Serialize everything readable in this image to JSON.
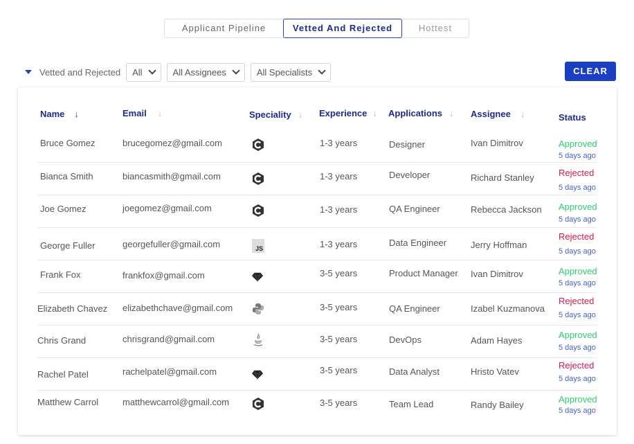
{
  "tabs": [
    {
      "label": "Applicant Pipeline"
    },
    {
      "label": "Vetted And Rejected"
    },
    {
      "label": "Hottest"
    }
  ],
  "filters": {
    "section_label": "Vetted and Rejected",
    "status_select": "All",
    "assignee_select": "All Assignees",
    "specialist_select": "All Specialists",
    "clear_label": "CLEAR"
  },
  "table": {
    "headers": {
      "name": "Name",
      "email": "Email",
      "speciality": "Speciality",
      "experience": "Experience",
      "applications": "Applications",
      "assignee": "Assignee",
      "status": "Status"
    },
    "rows": [
      {
        "name": "Bruce Gomez",
        "email": "brucegomez@gmail.com",
        "speciality_icon": "c-hexagon-icon",
        "experience": "1-3 years",
        "application": "Designer",
        "assignee": "Ivan Dimitrov",
        "status": "Approved",
        "ago": "5 days ago"
      },
      {
        "name": "Bianca Smith",
        "email": "biancasmith@gmail.com",
        "speciality_icon": "c-hexagon-icon",
        "experience": "1-3 years",
        "application": "Developer",
        "assignee": "Richard Stanley",
        "status": "Rejected",
        "ago": "5 days ago"
      },
      {
        "name": "Joe Gomez",
        "email": "joegomez@gmail.com",
        "speciality_icon": "c-hexagon-icon",
        "experience": "1-3 years",
        "application": "QA Engineer",
        "assignee": "Rebecca Jackson",
        "status": "Approved",
        "ago": "5 days ago"
      },
      {
        "name": "George Fuller",
        "email": "georgefuller@gmail.com",
        "speciality_icon": "js-icon",
        "experience": "1-3 years",
        "application": "Data Engineer",
        "assignee": "Jerry Hoffman",
        "status": "Rejected",
        "ago": "5 days ago"
      },
      {
        "name": "Frank Fox",
        "email": "frankfox@gmail.com",
        "speciality_icon": "ruby-icon",
        "experience": "3-5 years",
        "application": "Product Manager",
        "assignee": "Ivan Dimitrov",
        "status": "Approved",
        "ago": "5 days ago"
      },
      {
        "name": "Elizabeth Chavez",
        "email": "elizabethchave@gmail.com",
        "speciality_icon": "python-icon",
        "experience": "3-5 years",
        "application": "QA Engineer",
        "assignee": "Izabel Kuzmanova",
        "status": "Rejected",
        "ago": "5 days ago"
      },
      {
        "name": "Chris Grand",
        "email": "chrisgrand@gmail.com",
        "speciality_icon": "java-icon",
        "experience": "3-5 years",
        "application": "DevOps",
        "assignee": "Adam Hayes",
        "status": "Approved",
        "ago": "5 days ago"
      },
      {
        "name": "Rachel Patel",
        "email": "rachelpatel@gmail.com",
        "speciality_icon": "ruby-icon",
        "experience": "3-5 years",
        "application": "Data Analyst",
        "assignee": "Hristo Vatev",
        "status": "Rejected",
        "ago": "5 days ago"
      },
      {
        "name": "Matthew Carrol",
        "email": "matthewcarrol@gmail.com",
        "speciality_icon": "c-hexagon-icon",
        "experience": "3-5 years",
        "application": "Team Lead",
        "assignee": "Randy Bailey",
        "status": "Approved",
        "ago": "5 days ago"
      }
    ]
  },
  "colors": {
    "accent": "#1a3fc0",
    "approved": "#2ecc71",
    "rejected": "#d81b4a",
    "header_text": "#1a2b8c"
  }
}
